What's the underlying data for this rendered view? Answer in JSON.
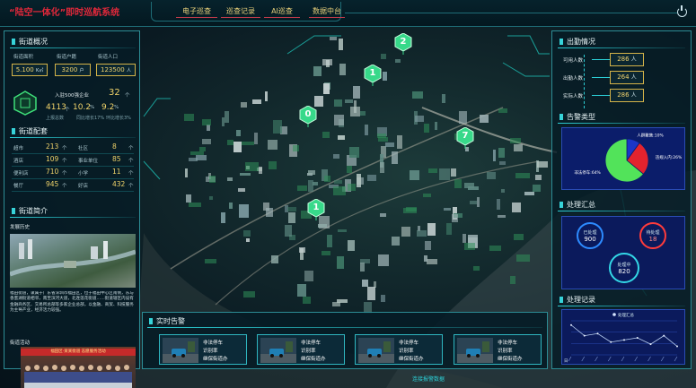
{
  "header": {
    "title_quote": "“陆空一体化”",
    "title_rest": "即时巡航系统",
    "tabs": [
      {
        "label": "电子巡查",
        "active": true
      },
      {
        "label": "巡查记录",
        "active": false
      },
      {
        "label": "AI巡查",
        "active": false
      },
      {
        "label": "数据中台",
        "active": false
      }
    ]
  },
  "left": {
    "street_overview": {
      "title": "街道概况",
      "area_label": "街道面积",
      "area_value": "5.100",
      "area_unit": "K㎡",
      "households_label": "街道户籍",
      "households_value": "3200",
      "households_unit": "户",
      "population_label": "街道人口",
      "population_value": "123500",
      "population_unit": "人",
      "enterprise_label": "入驻500强企业",
      "enterprise_value": "32",
      "enterprise_unit": "个",
      "stat1_value": "4113",
      "stat1_unit": "个",
      "stat2_value": "10.2",
      "stat2_unit": "%",
      "stat3_value": "9.2",
      "stat3_unit": "%",
      "stat1_caption": "上报总数",
      "stat2_caption": "同比增长17%",
      "stat3_caption": "环比增长3%"
    },
    "street_facilities": {
      "title": "街道配套",
      "rows": [
        {
          "left_label": "超市",
          "left_value": "213",
          "left_unit": "个",
          "right_label": "社区",
          "right_value": "8",
          "right_unit": "个"
        },
        {
          "left_label": "酒店",
          "left_value": "109",
          "left_unit": "个",
          "right_label": "事业单位",
          "right_value": "85",
          "right_unit": "个"
        },
        {
          "left_label": "便利店",
          "left_value": "710",
          "left_unit": "个",
          "right_label": "小学",
          "right_value": "11",
          "right_unit": "个"
        },
        {
          "left_label": "餐厅",
          "left_value": "945",
          "left_unit": "个",
          "right_label": "好店",
          "right_value": "432",
          "right_unit": "个"
        }
      ]
    },
    "street_intro": {
      "title": "街道简介",
      "history_label": "发展历史",
      "paragraph": "福田街道，隶属于广东省深圳市福田区，位于福田中心区南侧，东与香蜜湖街道相邻，南至滨河大道，北连莲花街道……街道辖区内设有金融商务区、交易所总部等多家企业总部，以金融、商贸、科技服务为主导产业，经济活力较强。",
      "activity_label": "街道活动",
      "banner": "福田区·某某街道 志愿服务活动"
    }
  },
  "right": {
    "attendance": {
      "title": "出勤情况",
      "rows": [
        {
          "label": "可用人数",
          "value": "286",
          "unit": "人"
        },
        {
          "label": "出勤人数",
          "value": "264",
          "unit": "人"
        },
        {
          "label": "实际人数",
          "value": "286",
          "unit": "人"
        }
      ]
    },
    "alarm_types": {
      "title": "告警类型",
      "chart_data": {
        "type": "pie",
        "slices": [
          {
            "label": "人群聚集:10%",
            "value": 10,
            "color": "#1c36c8"
          },
          {
            "label": "违规入内:26%",
            "value": 26,
            "color": "#e3232e"
          },
          {
            "label": "非法停车:64%",
            "value": 64,
            "color": "#52e35a"
          }
        ]
      }
    },
    "processing_summary": {
      "title": "处理汇总",
      "items": [
        {
          "label": "已处理",
          "value": "900",
          "color": "#2d8bff"
        },
        {
          "label": "待处理",
          "value": "18",
          "color": "#ff3b3b"
        },
        {
          "label": "处理中",
          "value": "820",
          "color": "#33d7e6"
        }
      ]
    },
    "processing_records": {
      "title": "处理记录",
      "chart_data": {
        "type": "line",
        "legend": "处理汇总",
        "x_unit": "日",
        "values": [
          28,
          18,
          20,
          12,
          14,
          16,
          10,
          18,
          8
        ],
        "ylim": [
          0,
          32
        ]
      }
    }
  },
  "realtime_alerts": {
    "title": "实时告警",
    "cards": [
      {
        "line1": "非法停车",
        "line2": "识别率",
        "line3": "继保街道办"
      },
      {
        "line1": "非法停车",
        "line2": "识别率",
        "line3": "继保街道办"
      },
      {
        "line1": "非法停车",
        "line2": "识别率",
        "line3": "继保街道办"
      },
      {
        "line1": "非法停车",
        "line2": "识别率",
        "line3": "继保街道办"
      }
    ]
  },
  "map_markers": [
    {
      "label": "2"
    },
    {
      "label": "1"
    },
    {
      "label": "0"
    },
    {
      "label": "7"
    },
    {
      "label": "1"
    }
  ],
  "footer_tag": "连接报警数据",
  "colors": {
    "accent": "#2ccfd6",
    "gold": "#f0d36a",
    "title_red": "#e0283a"
  }
}
